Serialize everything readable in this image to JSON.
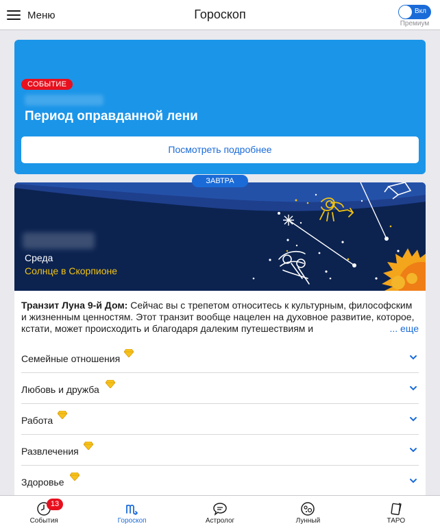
{
  "header": {
    "menu_label": "Меню",
    "title": "Гороскоп",
    "toggle_label": "Вкл",
    "premium_label": "Премиум"
  },
  "event": {
    "badge": "СОБЫТИЕ",
    "title": "Период оправданной лени",
    "more_button": "Посмотреть подробнее"
  },
  "tomorrow": {
    "pill": "ЗАВТРА",
    "day": "Среда",
    "sun_sign": "Солнце в Скорпионе",
    "transit_title": "Транзит Луна 9-й Дом:",
    "transit_text": " Сейчас вы с трепетом относитесь к культурным, философским и жизненным ценностям. Этот транзит вообще нацелен на духовное развитие, которое, кстати, может происходить и благодаря далеким путешествиям и",
    "more_link": "... еще"
  },
  "sections": [
    {
      "label": "Семейные отношения",
      "icon": "diamond-icon"
    },
    {
      "label": "Любовь и дружба",
      "icon": "diamond-icon"
    },
    {
      "label": "Работа",
      "icon": "diamond-icon"
    },
    {
      "label": "Развлечения",
      "icon": "diamond-icon"
    },
    {
      "label": "Здоровье",
      "icon": "diamond-icon"
    }
  ],
  "nav": [
    {
      "label": "События",
      "icon": "clock-icon",
      "badge": "13"
    },
    {
      "label": "Гороскоп",
      "icon": "scorpio-icon",
      "active": true
    },
    {
      "label": "Астролог",
      "icon": "chat-icon"
    },
    {
      "label": "Лунный",
      "icon": "moon-icon"
    },
    {
      "label": "ТАРО",
      "icon": "tarot-card-icon"
    }
  ],
  "colors": {
    "accent": "#1a6bd8",
    "event_bg": "#1b95e8",
    "badge_red": "#e8101e",
    "sky_bg": "#0c2350",
    "gold": "#f2c313"
  }
}
